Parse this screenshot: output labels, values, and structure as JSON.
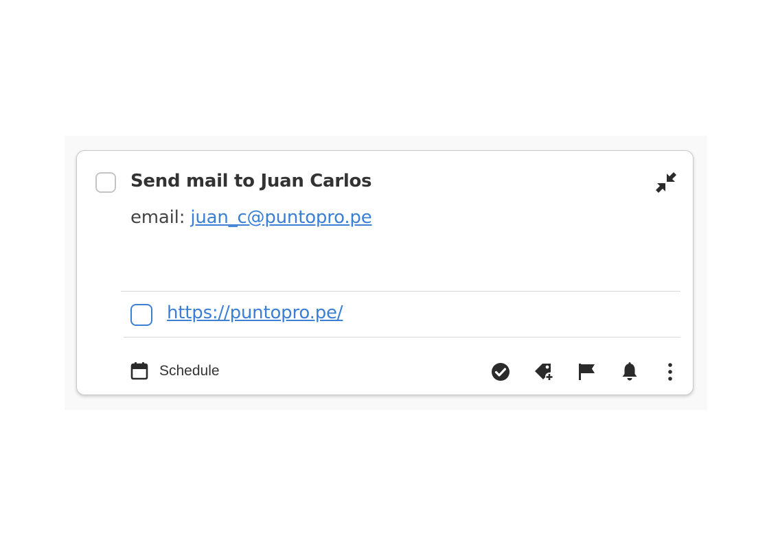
{
  "task": {
    "title": "Send mail to Juan Carlos",
    "notes_prefix": "email: ",
    "notes_link": "juan_c@puntopro.pe",
    "subtask_link": "https://puntopro.pe/"
  },
  "footer": {
    "schedule_label": "Schedule"
  },
  "icons": {
    "collapse": "collapse-arrows-icon",
    "calendar": "calendar-icon",
    "complete": "check-circle-icon",
    "tag": "add-tag-icon",
    "flag": "flag-icon",
    "reminder": "bell-icon",
    "more": "more-vertical-icon"
  },
  "colors": {
    "link": "#3a7fd5",
    "text": "#333333",
    "icon": "#2b2b2b"
  }
}
